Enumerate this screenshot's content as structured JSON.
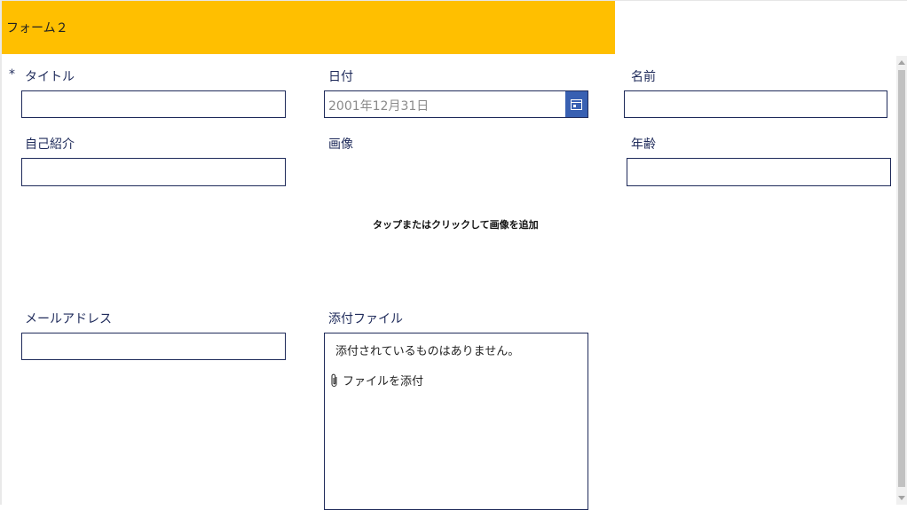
{
  "form": {
    "title": "フォーム２",
    "required_marker": "*"
  },
  "fields": {
    "title_label": "タイトル",
    "date_label": "日付",
    "date_value": "2001年12月31日",
    "name_label": "名前",
    "intro_label": "自己紹介",
    "image_label": "画像",
    "image_hint": "タップまたはクリックして画像を追加",
    "age_label": "年齢",
    "email_label": "メールアドレス",
    "attachment_label": "添付ファイル",
    "attachment_empty": "添付されているものはありません。",
    "attach_link": "ファイルを添付"
  },
  "colors": {
    "header": "#ffbf00",
    "text": "#1e2a5a",
    "calendar_button": "#3860b2"
  },
  "icons": {
    "calendar": "calendar-icon",
    "paperclip": "paperclip-icon"
  }
}
